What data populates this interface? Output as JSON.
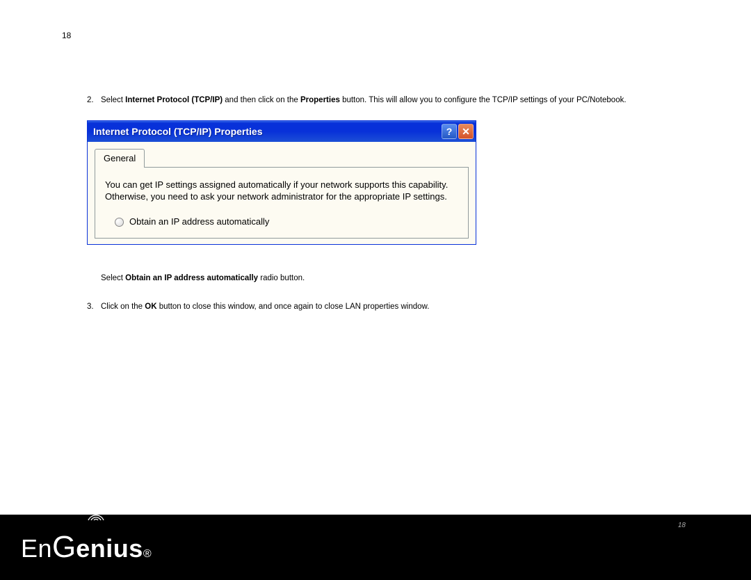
{
  "page_number_top": "18",
  "steps": {
    "step2_num": "2.",
    "step2_prefix": "Select ",
    "step2_bold1": "Internet Protocol (TCP/IP)",
    "step2_mid": " and then click on the ",
    "step2_bold2": "Properties",
    "step2_suffix": " button. This will allow you to configure the TCP/IP settings of your PC/Notebook.",
    "substep_prefix": "Select ",
    "substep_bold": "Obtain an IP address automatically",
    "substep_suffix": " radio button.",
    "step3_num": "3.",
    "step3_prefix": "Click on the ",
    "step3_bold": "OK",
    "step3_suffix": " button to close this window, and once again to close LAN properties window."
  },
  "xpwindow": {
    "title": "Internet Protocol (TCP/IP) Properties",
    "help_label": "?",
    "close_label": "✕",
    "tab_label": "General",
    "info_text": "You can get IP settings assigned automatically if your network supports this capability. Otherwise, you need to ask your network administrator for the appropriate IP settings.",
    "radio_label": "Obtain an IP address automatically"
  },
  "footer": {
    "brand_en": "En",
    "brand_g": "G",
    "brand_rest": "enius",
    "brand_r": "®",
    "page": "18"
  }
}
